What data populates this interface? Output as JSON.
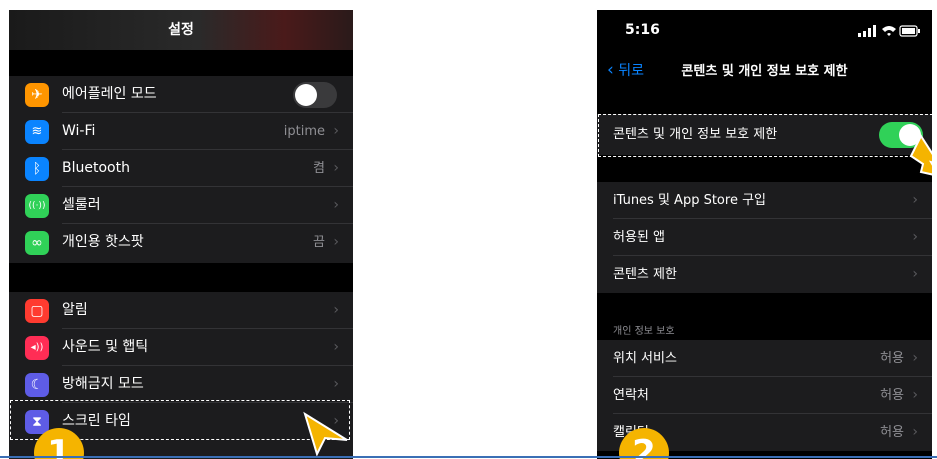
{
  "left": {
    "title": "설정",
    "group1": [
      {
        "label": "에어플레인 모드",
        "value": "",
        "icon": "airplane-icon",
        "color": "#ff9500",
        "glyph": "✈",
        "toggle": "off"
      },
      {
        "label": "Wi-Fi",
        "value": "iptime",
        "icon": "wifi-icon",
        "color": "#0a84ff",
        "glyph": "≋"
      },
      {
        "label": "Bluetooth",
        "value": "켬",
        "icon": "bluetooth-icon",
        "color": "#0a84ff",
        "glyph": "ᛒ"
      },
      {
        "label": "셀룰러",
        "value": "",
        "icon": "cellular-icon",
        "color": "#30d158",
        "glyph": "((·))"
      },
      {
        "label": "개인용 핫스팟",
        "value": "끔",
        "icon": "hotspot-icon",
        "color": "#30d158",
        "glyph": "∞"
      }
    ],
    "group2": [
      {
        "label": "알림",
        "value": "",
        "icon": "notifications-icon",
        "color": "#ff3b30",
        "glyph": "▢"
      },
      {
        "label": "사운드 및 햅틱",
        "value": "",
        "icon": "sound-icon",
        "color": "#ff2d55",
        "glyph": "◂))"
      },
      {
        "label": "방해금지 모드",
        "value": "",
        "icon": "moon-icon",
        "color": "#5e5ce6",
        "glyph": "☾"
      },
      {
        "label": "스크린 타임",
        "value": "",
        "icon": "hourglass-icon",
        "color": "#5e5ce6",
        "glyph": "⧗"
      }
    ],
    "step": "1"
  },
  "right": {
    "time": "5:16",
    "back": "뒤로",
    "title": "콘텐츠 및 개인 정보 보호 제한",
    "toggle_row": {
      "label": "콘텐츠 및 개인 정보 보호 제한",
      "toggle": "on"
    },
    "group1": [
      {
        "label": "iTunes 및 App Store 구입",
        "value": ""
      },
      {
        "label": "허용된 앱",
        "value": ""
      },
      {
        "label": "콘텐츠 제한",
        "value": ""
      }
    ],
    "section_header": "개인 정보 보호",
    "group2": [
      {
        "label": "위치 서비스",
        "value": "허용"
      },
      {
        "label": "연락처",
        "value": "허용"
      },
      {
        "label": "캘린더",
        "value": "허용"
      }
    ],
    "step": "2"
  },
  "colors": {
    "accent": "#0a84ff",
    "toggle_on": "#30d158",
    "badge": "#f5b400"
  }
}
